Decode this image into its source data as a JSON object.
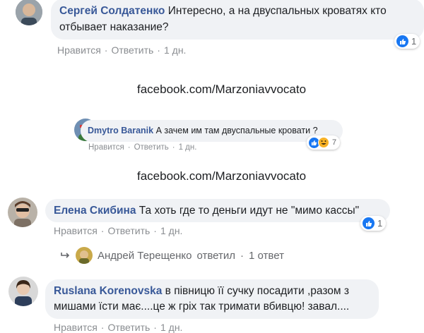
{
  "comments": [
    {
      "author": "Сергей Солдатенко",
      "text_line1": "Интересно, а на двуспальных кроватях кто",
      "text_line2": "отбывает наказание?",
      "like_label": "Нравится",
      "reply_label": "Ответить",
      "time": "1 дн.",
      "reaction_count": "1",
      "reactions": [
        "like-icon"
      ]
    },
    {
      "author": "Dmytro Baranik",
      "text_line1": "А зачем им там двуспальные кровати ?",
      "like_label": "Нравится",
      "reply_label": "Ответить",
      "time": "1 дн.",
      "reaction_count": "7",
      "reactions": [
        "like-icon",
        "haha-icon"
      ]
    },
    {
      "author": "Елена Скибина",
      "text_line1": "Та хоть где то деньги идут не \"мимо кассы\"",
      "like_label": "Нравится",
      "reply_label": "Ответить",
      "time": "1 дн.",
      "reaction_count": "1",
      "reactions": [
        "like-icon"
      ]
    },
    {
      "author": "Ruslana Korenovska",
      "text_line1": "в півницю її сучку посадити ,разом з",
      "text_line2": "мишами їсти має....це ж гріх так тримати вбивцю! завал....",
      "like_label": "Нравится",
      "reply_label": "Ответить",
      "time": "1 дн."
    }
  ],
  "watermark": "facebook.com/Marzoniavvocato",
  "reply_thread": {
    "author": "Андрей Терещенко",
    "action": "ответил",
    "count": "1 ответ"
  },
  "separator": "·",
  "colors": {
    "author_name": "#385898",
    "bubble_bg": "#f0f2f5",
    "like_blue": "#1877f2",
    "meta_gray": "#8a8d91"
  }
}
